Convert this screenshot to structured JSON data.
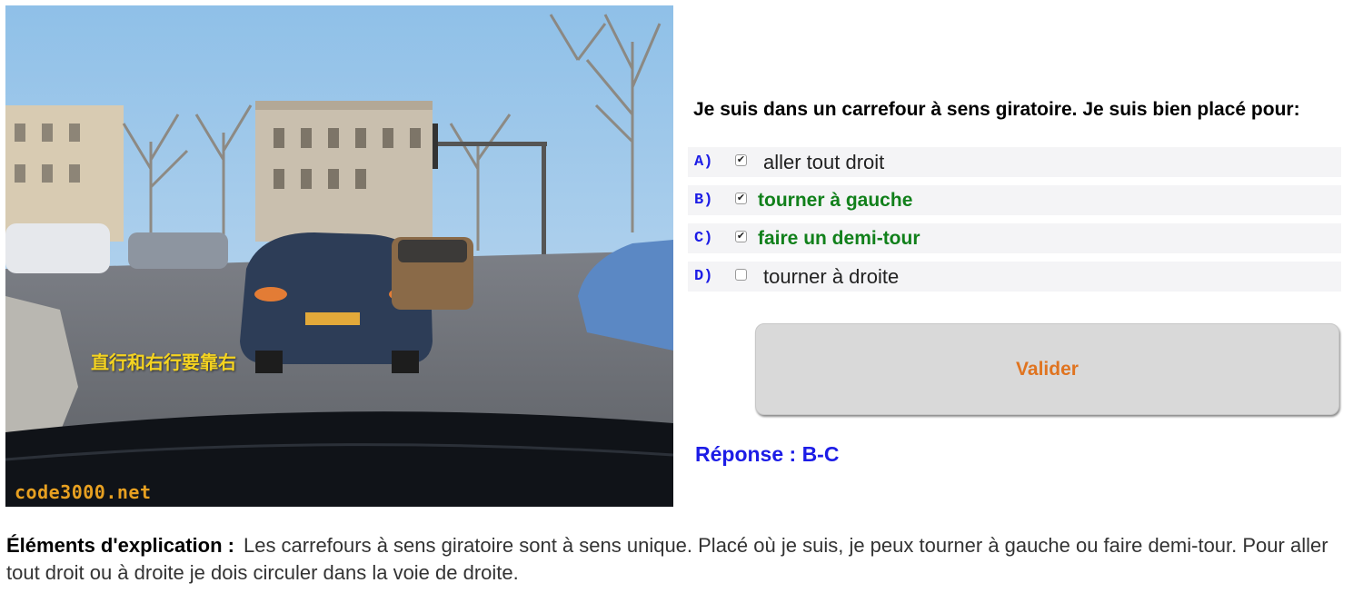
{
  "photo": {
    "caption": "直行和右行要靠右",
    "watermark": "code3000.net"
  },
  "question": {
    "text": "Je suis dans un carrefour à sens giratoire. Je suis bien placé pour:"
  },
  "answers": [
    {
      "letter": "A)",
      "checked": true,
      "text": "aller tout droit",
      "correct": false
    },
    {
      "letter": "B)",
      "checked": true,
      "text": "tourner à gauche",
      "correct": true
    },
    {
      "letter": "C)",
      "checked": true,
      "text": "faire un demi-tour",
      "correct": true
    },
    {
      "letter": "D)",
      "checked": false,
      "text": "tourner à droite",
      "correct": false
    }
  ],
  "validate_label": "Valider",
  "response": "Réponse : B-C",
  "explanation": {
    "label": "Éléments d'explication :",
    "text": "Les carrefours à sens giratoire sont à sens unique. Placé où je suis, je peux tourner à gauche ou faire demi-tour. Pour aller tout droit ou à droite je dois circuler dans la voie de droite."
  },
  "colors": {
    "letter": "#1c1ce6",
    "correct": "#11801b",
    "validate_text": "#e07420",
    "response": "#1c1ce6",
    "row_bg": "#f4f4f6"
  }
}
